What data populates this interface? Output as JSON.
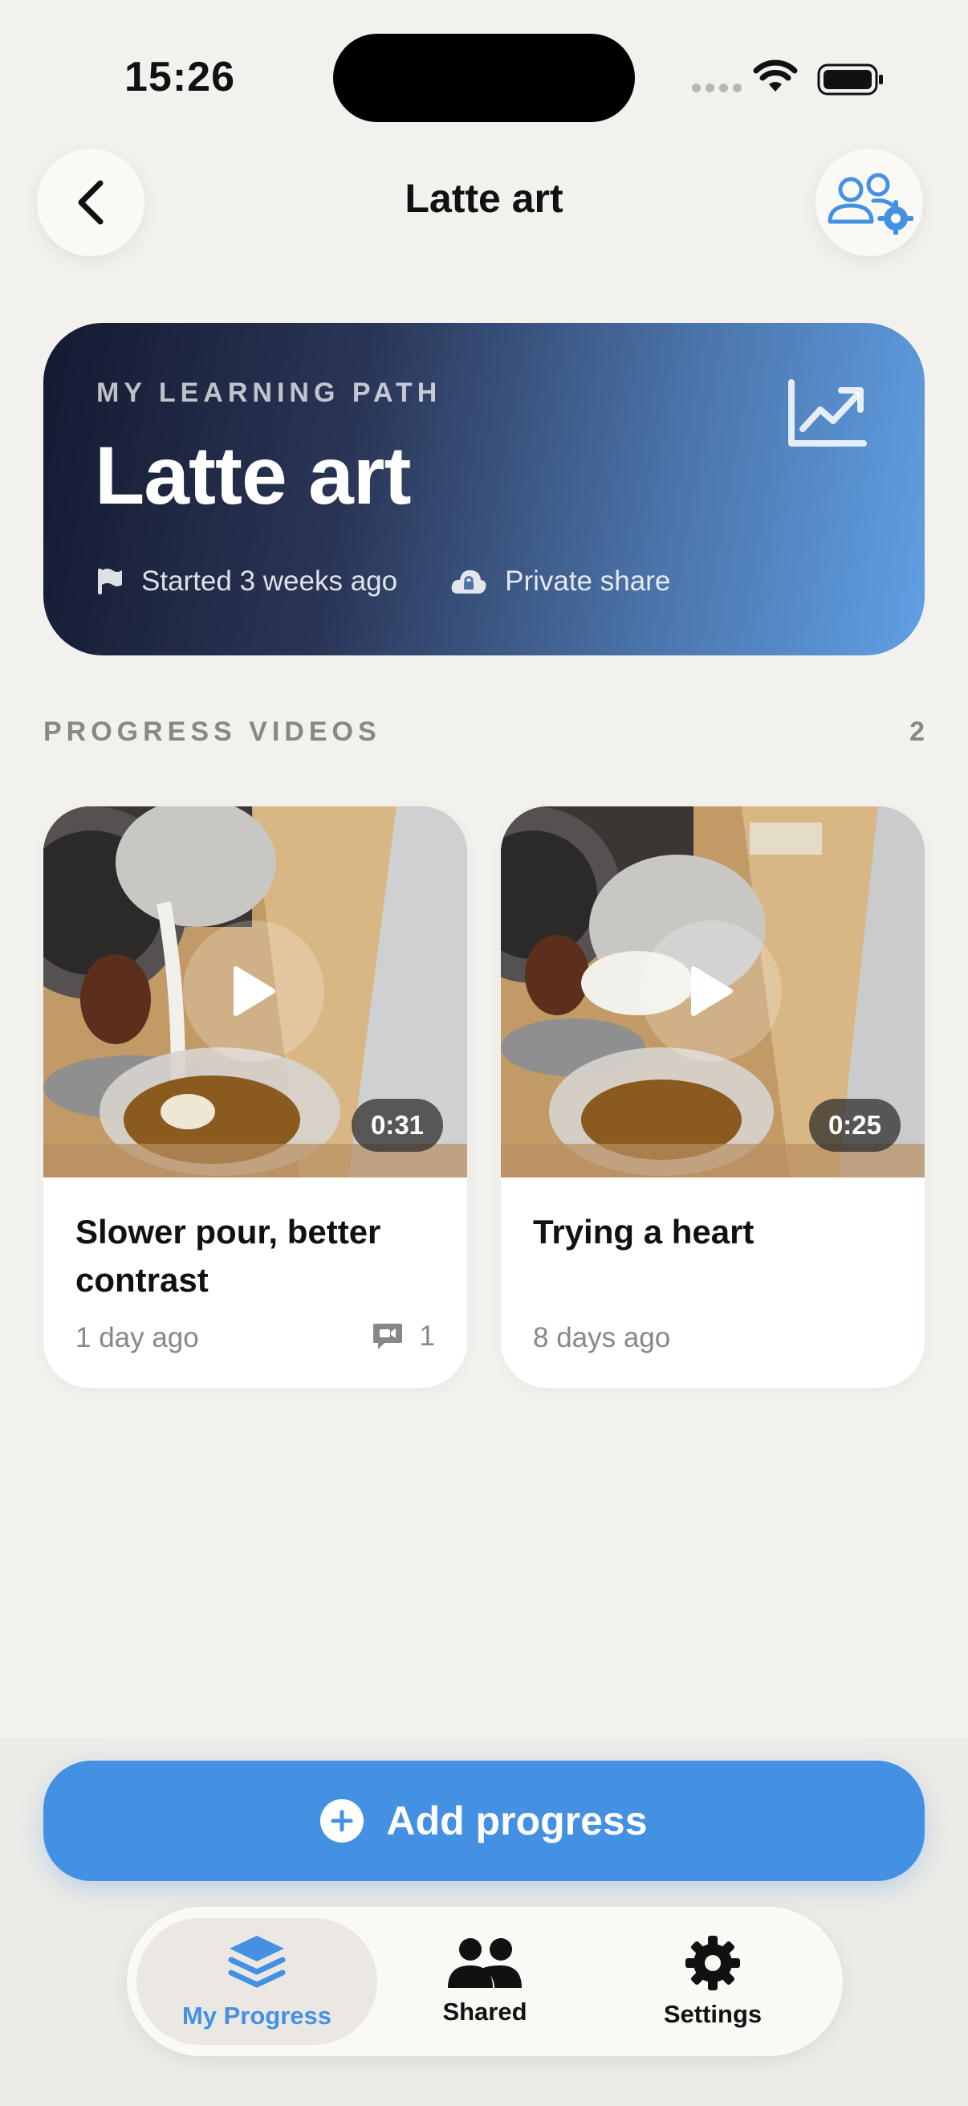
{
  "status_bar": {
    "time": "15:26"
  },
  "header": {
    "title": "Latte art"
  },
  "hero": {
    "kicker": "MY LEARNING PATH",
    "title": "Latte art",
    "started": "Started 3 weeks ago",
    "share": "Private share"
  },
  "section": {
    "label": "PROGRESS VIDEOS",
    "count": "2"
  },
  "videos": [
    {
      "title": "Slower pour, better contrast",
      "date": "1 day ago",
      "duration": "0:31",
      "comments": "1"
    },
    {
      "title": "Trying a heart",
      "date": "8 days ago",
      "duration": "0:25"
    }
  ],
  "actions": {
    "add_progress": "Add progress"
  },
  "tabs": [
    {
      "label": "My Progress",
      "icon": "layers-icon",
      "active": true
    },
    {
      "label": "Shared",
      "icon": "people-icon"
    },
    {
      "label": "Settings",
      "icon": "gear-icon"
    }
  ],
  "colors": {
    "accent": "#4491e4",
    "background": "#f3f1ed",
    "hero_start": "#141a30",
    "hero_end": "#60a0e4"
  }
}
